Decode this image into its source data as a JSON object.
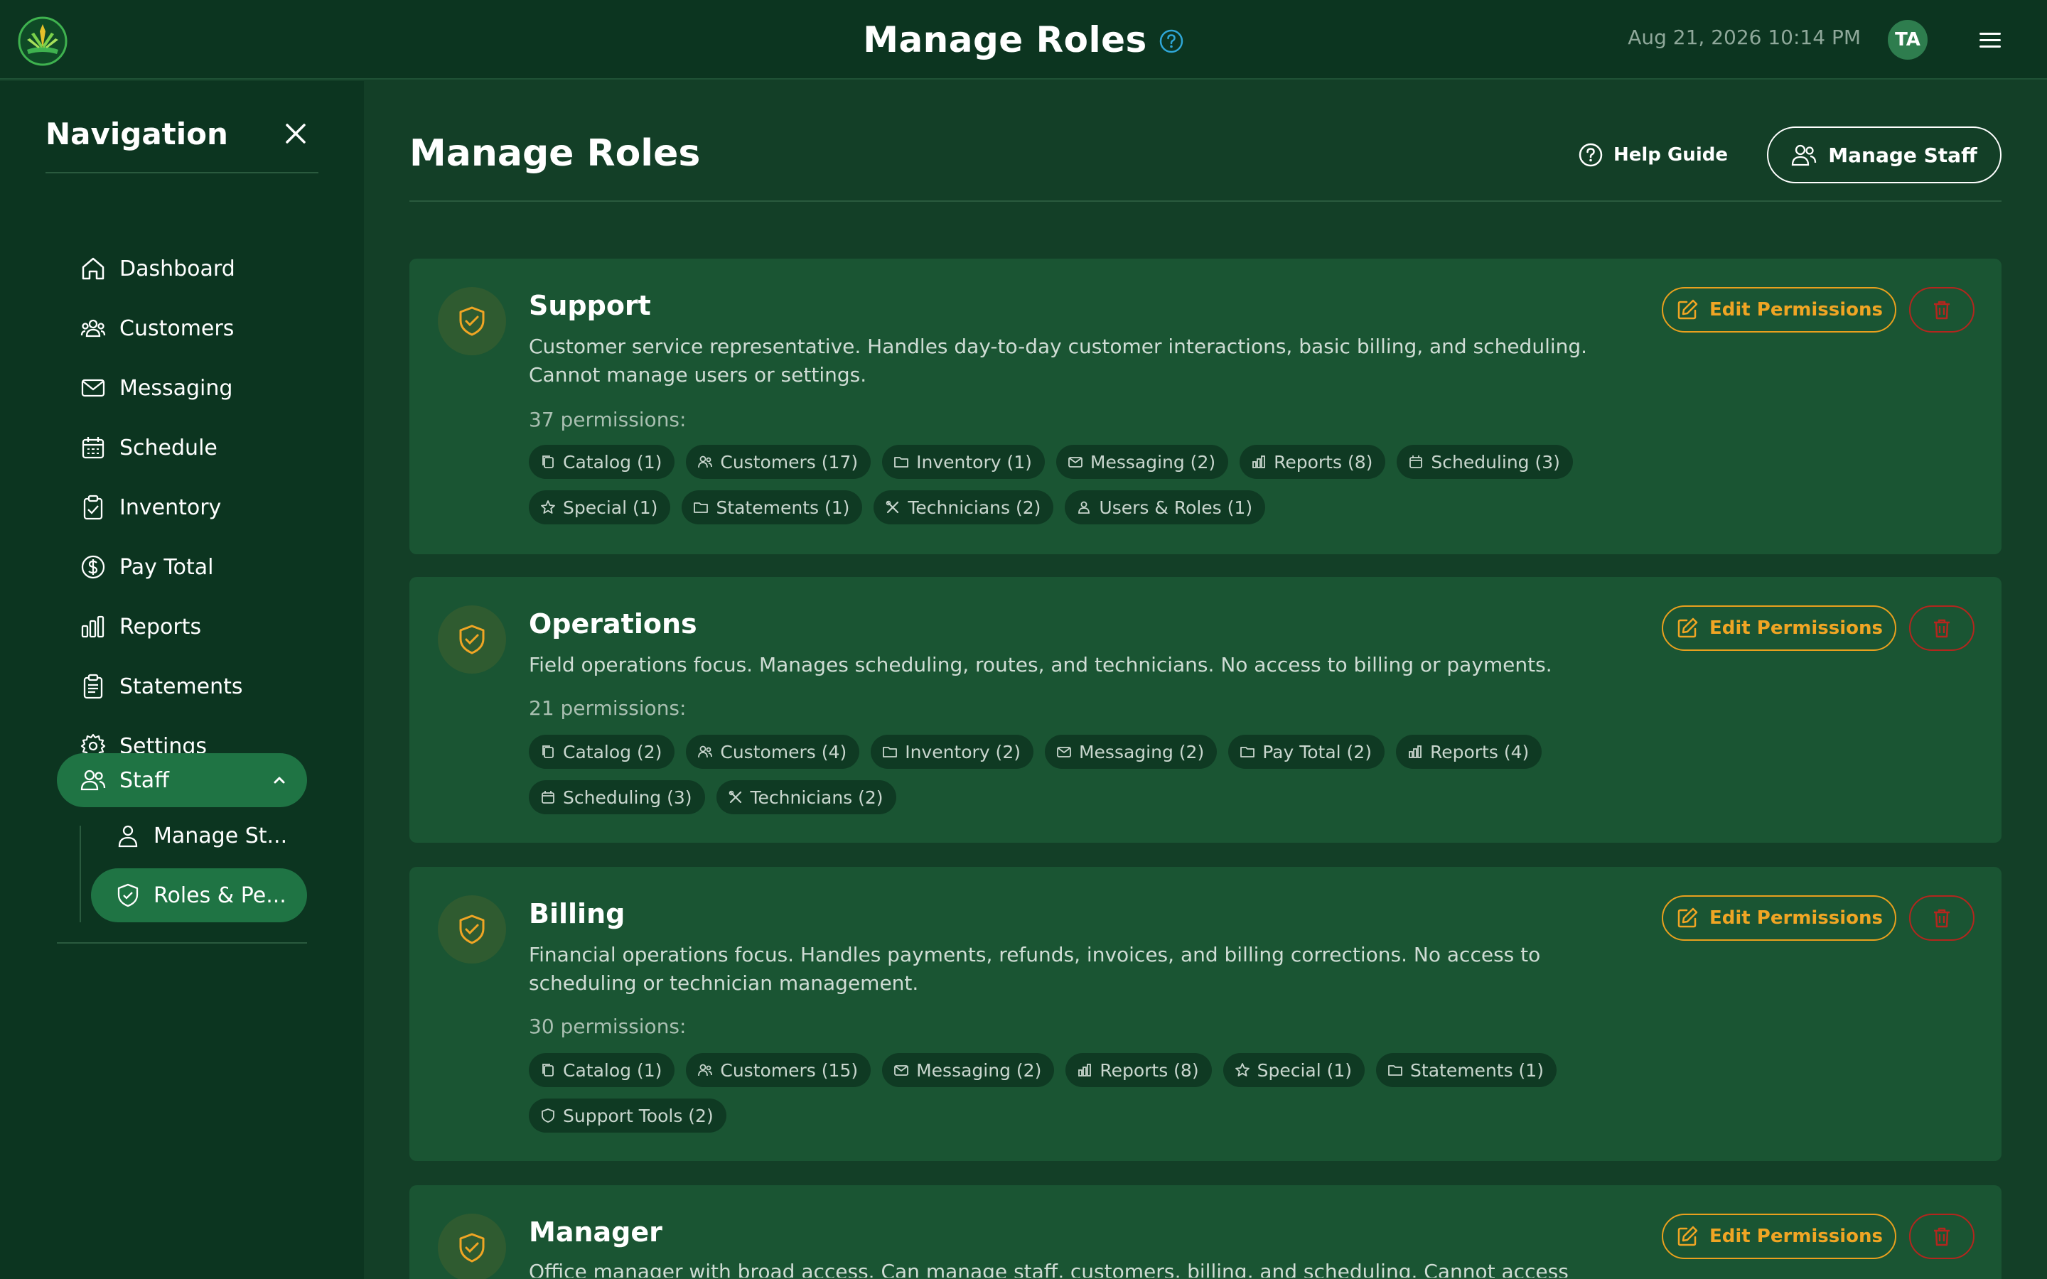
{
  "header": {
    "title": "Manage Roles",
    "datetime": "Aug 21, 2026 10:14 PM",
    "avatar_initials": "TA"
  },
  "sidebar": {
    "title": "Navigation",
    "items": [
      {
        "label": "Dashboard",
        "icon": "home-icon"
      },
      {
        "label": "Customers",
        "icon": "users-icon"
      },
      {
        "label": "Messaging",
        "icon": "mail-icon"
      },
      {
        "label": "Schedule",
        "icon": "calendar-icon"
      },
      {
        "label": "Inventory",
        "icon": "clipboard-check-icon"
      },
      {
        "label": "Pay Total",
        "icon": "dollar-circle-icon"
      },
      {
        "label": "Reports",
        "icon": "bar-chart-icon"
      },
      {
        "label": "Statements",
        "icon": "document-icon"
      },
      {
        "label": "Settings",
        "icon": "gear-icon"
      }
    ],
    "staff": {
      "label": "Staff",
      "children": [
        {
          "label": "Manage St..."
        },
        {
          "label": "Roles & Pe..."
        }
      ]
    }
  },
  "main": {
    "title": "Manage Roles",
    "help_label": "Help Guide",
    "manage_staff_label": "Manage Staff",
    "edit_label": "Edit Permissions",
    "roles": [
      {
        "name": "Support",
        "description": "Customer service representative. Handles day-to-day customer interactions, basic billing, and scheduling. Cannot manage users or settings.",
        "count": "37 permissions:",
        "tags": [
          "Catalog (1)",
          "Customers (17)",
          "Inventory (1)",
          "Messaging (2)",
          "Reports (8)",
          "Scheduling (3)",
          "Special (1)",
          "Statements (1)",
          "Technicians (2)",
          "Users & Roles (1)"
        ]
      },
      {
        "name": "Operations",
        "description": "Field operations focus. Manages scheduling, routes, and technicians. No access to billing or payments.",
        "count": "21 permissions:",
        "tags": [
          "Catalog (2)",
          "Customers (4)",
          "Inventory (2)",
          "Messaging (2)",
          "Pay Total (2)",
          "Reports (4)",
          "Scheduling (3)",
          "Technicians (2)"
        ]
      },
      {
        "name": "Billing",
        "description": "Financial operations focus. Handles payments, refunds, invoices, and billing corrections. No access to scheduling or technician management.",
        "count": "30 permissions:",
        "tags": [
          "Catalog (1)",
          "Customers (15)",
          "Messaging (2)",
          "Reports (8)",
          "Special (1)",
          "Statements (1)",
          "Support Tools (2)"
        ]
      },
      {
        "name": "Manager",
        "description": "Office manager with broad access. Can manage staff, customers, billing, and scheduling. Cannot access",
        "count": "",
        "tags": []
      }
    ]
  },
  "colors": {
    "background": "#133f27",
    "header": "#0c3520",
    "card": "#1a5533",
    "accent_orange": "#f0a524",
    "danger_red": "#b3261e",
    "active_green": "#1f7444"
  }
}
